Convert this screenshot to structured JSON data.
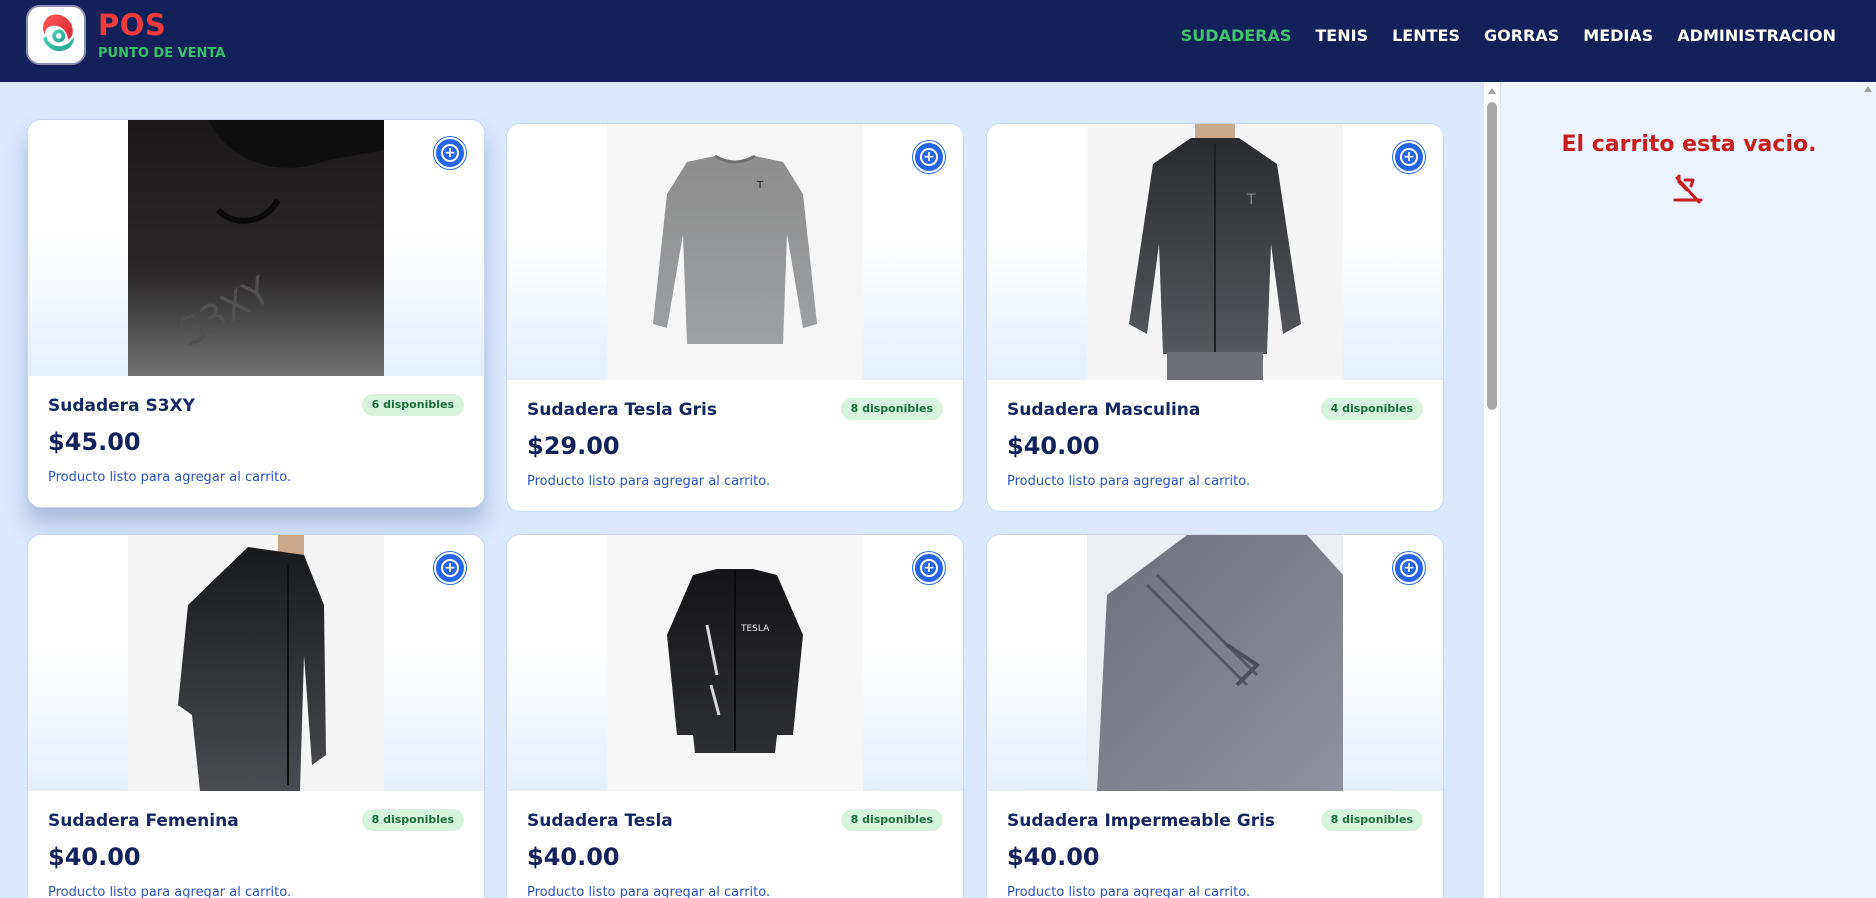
{
  "brand": {
    "title": "POS",
    "subtitle": "PUNTO DE VENTA"
  },
  "nav": {
    "items": [
      {
        "label": "SUDADERAS",
        "active": true
      },
      {
        "label": "TENIS",
        "active": false
      },
      {
        "label": "LENTES",
        "active": false
      },
      {
        "label": "GORRAS",
        "active": false
      },
      {
        "label": "MEDIAS",
        "active": false
      },
      {
        "label": "ADMINISTRACION",
        "active": false
      }
    ]
  },
  "products": [
    {
      "name": "Sudadera S3XY",
      "availability": "6 disponibles",
      "price": "$45.00",
      "description": "Producto listo para agregar al carrito.",
      "image": "hoodie-s3xy"
    },
    {
      "name": "Sudadera Tesla Gris",
      "availability": "8 disponibles",
      "price": "$29.00",
      "description": "Producto listo para agregar al carrito.",
      "image": "longsleeve-grey"
    },
    {
      "name": "Sudadera Masculina",
      "availability": "4 disponibles",
      "price": "$40.00",
      "description": "Producto listo para agregar al carrito.",
      "image": "jacket-male"
    },
    {
      "name": "Sudadera Femenina",
      "availability": "8 disponibles",
      "price": "$40.00",
      "description": "Producto listo para agregar al carrito.",
      "image": "jacket-female"
    },
    {
      "name": "Sudadera Tesla",
      "availability": "8 disponibles",
      "price": "$40.00",
      "description": "Producto listo para agregar al carrito.",
      "image": "jacket-black-flat"
    },
    {
      "name": "Sudadera Impermeable Gris",
      "availability": "8 disponibles",
      "price": "$40.00",
      "description": "Producto listo para agregar al carrito.",
      "image": "jacket-grey-closeup"
    }
  ],
  "cart": {
    "empty_message": "El carrito esta vacio.",
    "icon": "cart-off-icon"
  },
  "colors": {
    "header": "#13215a",
    "brand_red": "#ef3b3b",
    "brand_green": "#38c06a",
    "active_nav": "#3fc36b",
    "accent_blue": "#2566e8",
    "badge_bg": "#d6f3de",
    "cart_empty_red": "#c71f1f",
    "page_bg": "#dbe9fe"
  }
}
